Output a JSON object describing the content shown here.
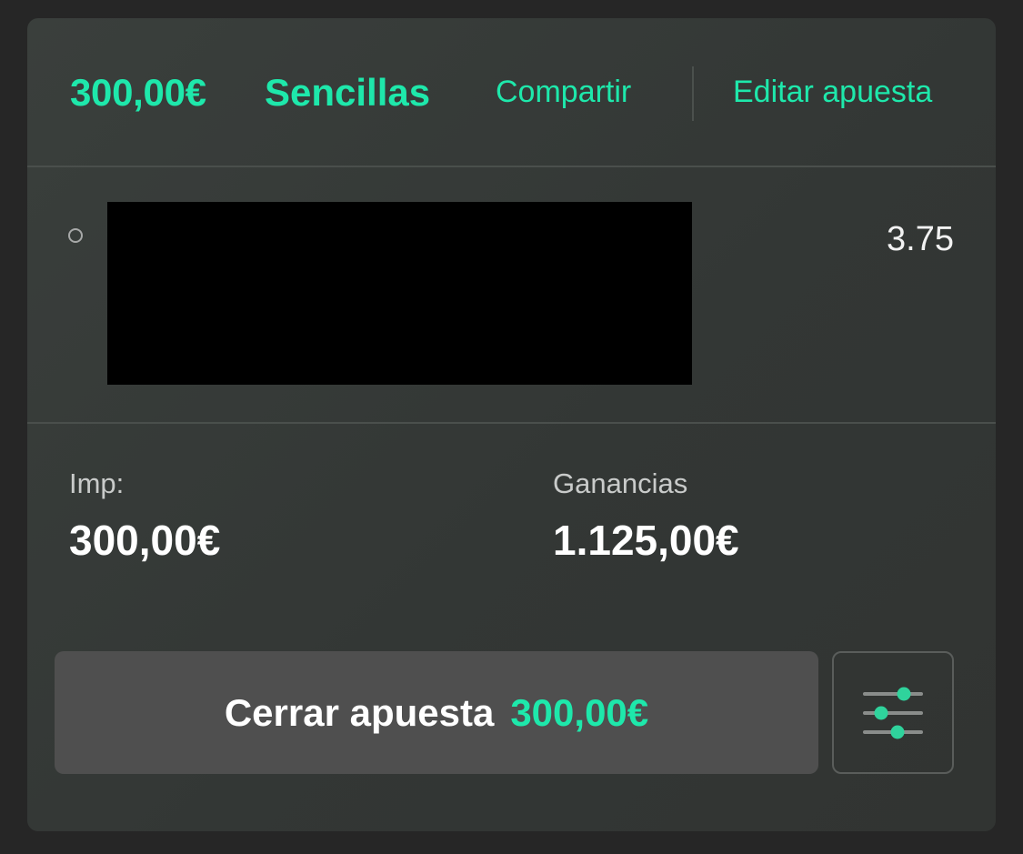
{
  "header": {
    "amount": "300,00€",
    "bet_type": "Sencillas",
    "share_label": "Compartir",
    "edit_label": "Editar apuesta"
  },
  "selection": {
    "odds": "3.75"
  },
  "summary": {
    "stake_label": "Imp:",
    "stake_value": "300,00€",
    "winnings_label": "Ganancias",
    "winnings_value": "1.125,00€"
  },
  "actions": {
    "cashout_label": "Cerrar apuesta",
    "cashout_amount": "300,00€",
    "settings_icon": "sliders-icon"
  },
  "colors": {
    "accent": "#1ee8ab",
    "card_bg": "#353937",
    "page_bg": "#262626",
    "button_bg": "#4f4f4f"
  }
}
